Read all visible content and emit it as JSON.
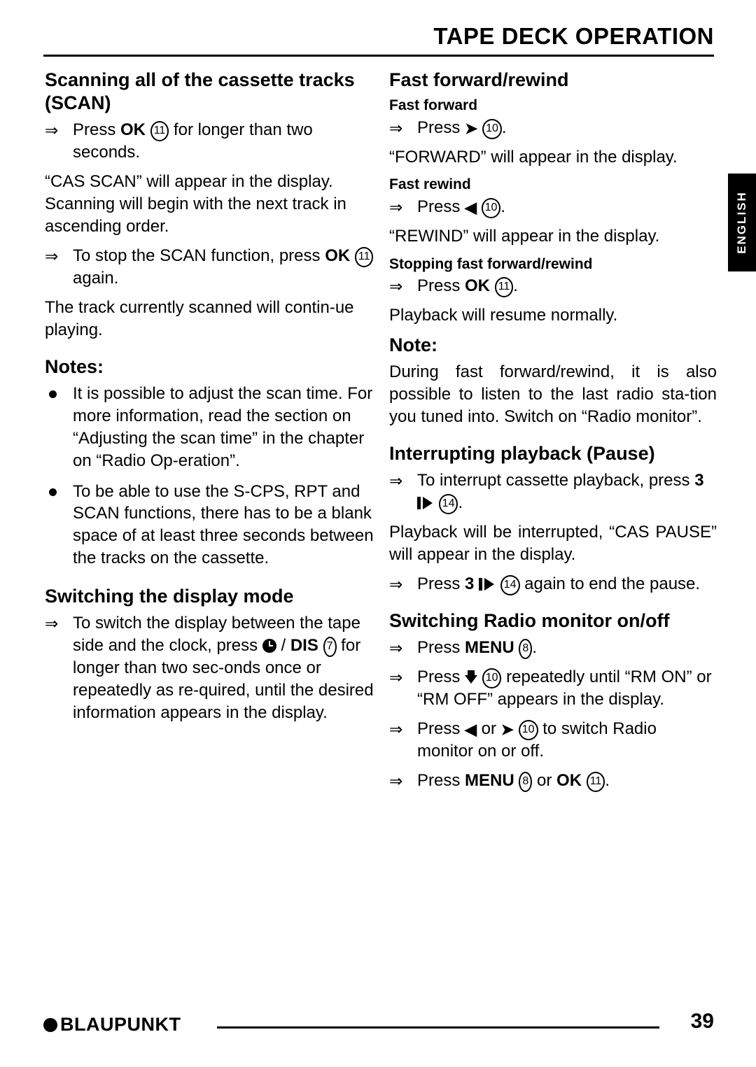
{
  "header": {
    "title": "TAPE DECK OPERATION"
  },
  "side_tab": {
    "label": "ENGLISH"
  },
  "left_column": {
    "scan": {
      "heading": "Scanning all of the cassette tracks (SCAN)",
      "step1_pre": "Press ",
      "step1_bold": "OK",
      "step1_num": "11",
      "step1_post": " for longer than two seconds.",
      "para1": "“CAS SCAN” will appear in the display. Scanning will begin with the next track in ascending order.",
      "step2_pre": "To stop the SCAN function, press ",
      "step2_bold": "OK",
      "step2_num": "11",
      "step2_post": " again.",
      "para2": "The track currently scanned will contin-ue playing."
    },
    "notes": {
      "heading": "Notes:",
      "items": [
        "It is possible to adjust the scan time. For more information, read the section on “Adjusting the scan time” in the chapter on “Radio Op-eration”.",
        "To be able to use the S-CPS, RPT and SCAN functions, there has to be a blank space of at least three seconds between the tracks on the cassette."
      ]
    },
    "display_mode": {
      "heading": "Switching the display mode",
      "step_pre": "To switch the display between the tape side and the clock, press ",
      "step_icon": "clock-icon",
      "step_mid": " / ",
      "step_bold": "DIS",
      "step_num": "7",
      "step_post": " for longer than two sec-onds once or repeatedly as re-quired, until the desired information appears in the display."
    }
  },
  "right_column": {
    "fast_fwd_rew": {
      "heading": "Fast forward/rewind",
      "fast_forward": {
        "subheading": "Fast forward",
        "step_pre": "Press ",
        "step_icon": "fast-forward-icon",
        "step_num": "10",
        "step_post": ".",
        "para": "“FORWARD” will appear in the display."
      },
      "fast_rewind": {
        "subheading": "Fast rewind",
        "step_pre": "Press ",
        "step_icon": "rewind-icon",
        "step_num": "10",
        "step_post": ".",
        "para": "“REWIND” will appear in the display."
      },
      "stopping": {
        "subheading": "Stopping fast forward/rewind",
        "step_pre": "Press ",
        "step_bold": "OK",
        "step_num": "11",
        "step_post": ".",
        "para": "Playback will resume normally."
      },
      "note": {
        "heading": "Note:",
        "text": "During fast forward/rewind, it is also possible to listen to the last radio sta-tion you tuned into. Switch on “Radio monitor”."
      }
    },
    "pause": {
      "heading": "Interrupting playback (Pause)",
      "step1_pre": "To interrupt cassette playback, press ",
      "step1_key": "3",
      "step1_num": "14",
      "step1_post": ".",
      "para": "Playback will be interrupted, “CAS PAUSE” will appear in the display.",
      "step2_pre": "Press ",
      "step2_key": "3",
      "step2_num": "14",
      "step2_post": " again to end the pause."
    },
    "radio_monitor": {
      "heading": "Switching Radio monitor on/off",
      "step1_pre": "Press ",
      "step1_bold": "MENU",
      "step1_num": "8",
      "step1_post": ".",
      "step2_pre": "Press ",
      "step2_icon": "down-arrow-icon",
      "step2_num": "10",
      "step2_post": " repeatedly until “RM ON” or “RM OFF” appears in the display.",
      "step3_pre": "Press ",
      "step3_icon_left": "rewind-icon",
      "step3_mid": " or ",
      "step3_icon_right": "fast-forward-icon",
      "step3_num": "10",
      "step3_post": " to switch Radio monitor on or off.",
      "step4_pre": "Press ",
      "step4_bold1": "MENU",
      "step4_num1": "8",
      "step4_mid": " or ",
      "step4_bold2": "OK",
      "step4_num2": "11",
      "step4_post": "."
    }
  },
  "footer": {
    "brand": "BLAUPUNKT",
    "page_number": "39"
  }
}
